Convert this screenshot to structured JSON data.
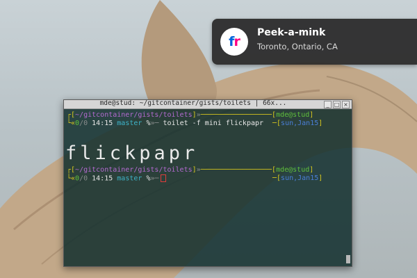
{
  "notification": {
    "app_icon": "flickr-logo-icon",
    "icon_text": "fr",
    "title": "Peek-a-mink",
    "body": "Toronto, Ontario, CA"
  },
  "terminal": {
    "title": "mde@stud: ~/gitcontainer/gists/toilets | 66x...",
    "prompt1": {
      "path": "~/gitcontainer/gists/toilets",
      "host": "mde@stud",
      "status": "0",
      "time": "14:15",
      "branch": "master",
      "flag": "%",
      "command": "toilet -f mini flickpapr",
      "date": "sun,Jan15"
    },
    "banner_text": "flickpapr",
    "prompt2": {
      "path": "~/gitcontainer/gists/toilets",
      "host": "mde@stud",
      "status": "0",
      "time": "14:15",
      "branch": "master",
      "flag": "%",
      "date": "sun,Jan15"
    }
  },
  "window_buttons": {
    "minimize": "_",
    "maximize": "□",
    "close": "×"
  }
}
